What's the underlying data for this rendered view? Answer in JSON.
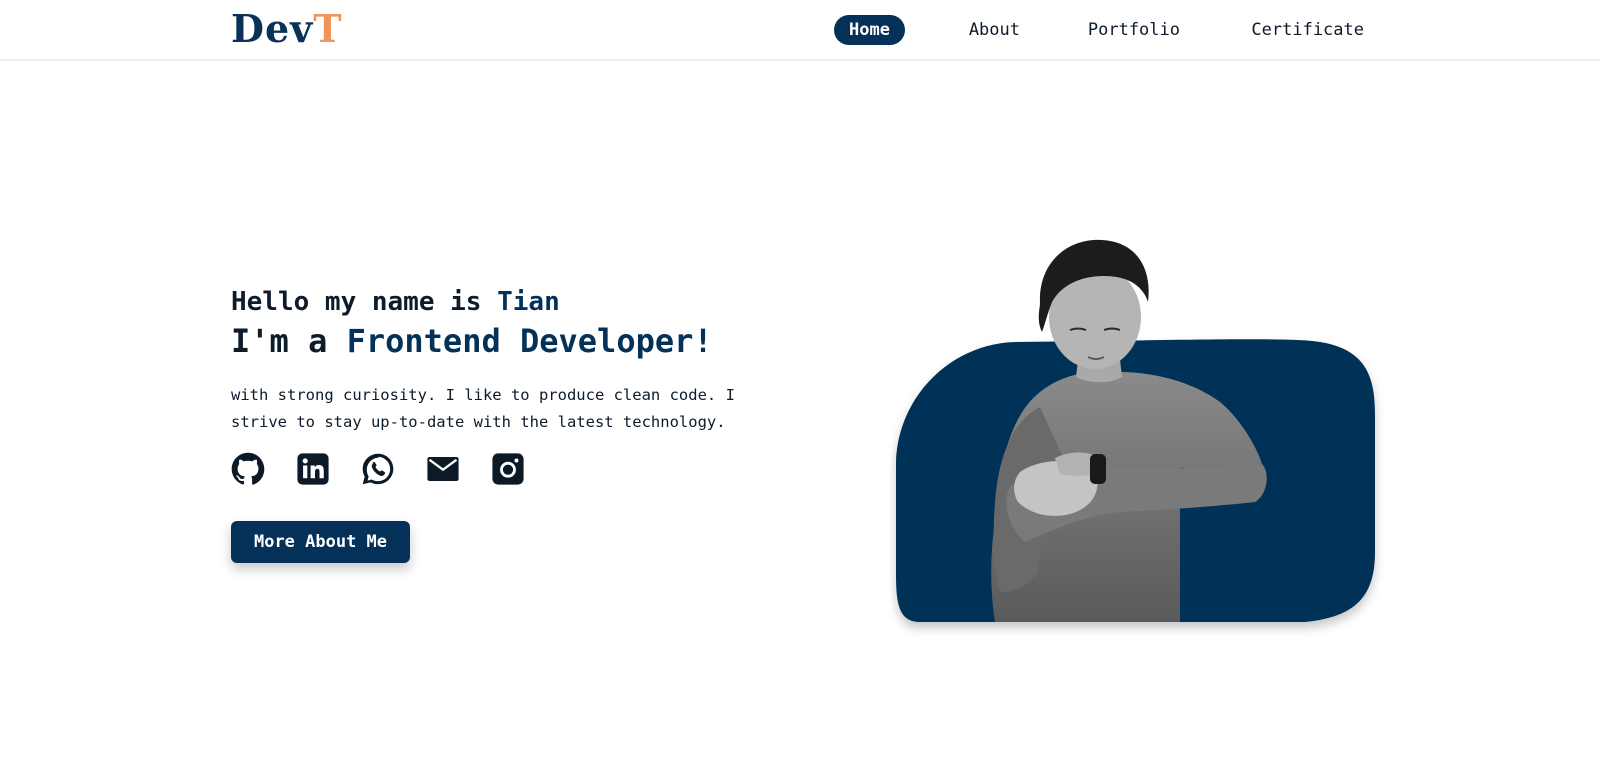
{
  "header": {
    "logo_main": "Dev",
    "logo_accent": "T",
    "nav": {
      "home": "Home",
      "about": "About",
      "portfolio": "Portfolio",
      "certificate": "Certificate"
    }
  },
  "hero": {
    "greeting_prefix": "Hello my name is ",
    "name": "Tian",
    "role_prefix": "I'm a ",
    "role_title": "Frontend Developer!",
    "description": "with strong curiosity. I like to produce clean code. I strive to stay up-to-date with the latest technology.",
    "cta_label": "More About Me"
  },
  "socials": [
    "github-icon",
    "linkedin-icon",
    "whatsapp-icon",
    "mail-icon",
    "instagram-icon"
  ],
  "colors": {
    "primary": "#053159",
    "accent": "#f0955a",
    "text": "#0d1b2a",
    "background": "#ffffff"
  }
}
